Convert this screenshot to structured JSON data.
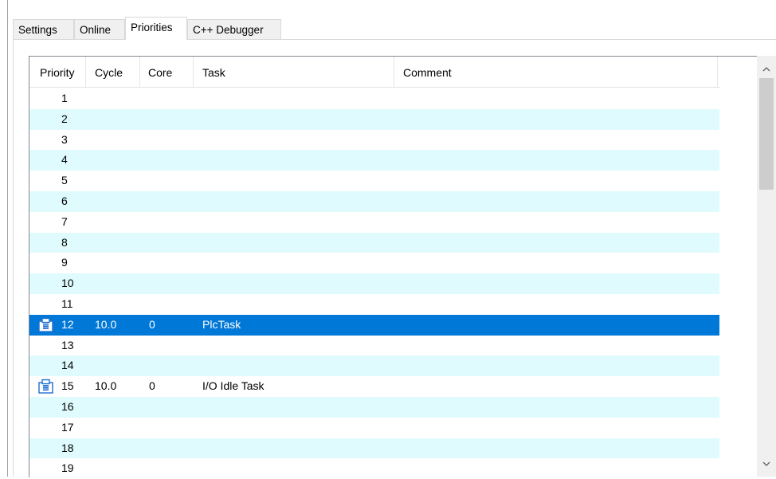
{
  "tabs": [
    {
      "label": "Settings",
      "active": false
    },
    {
      "label": "Online",
      "active": false
    },
    {
      "label": "Priorities",
      "active": true
    },
    {
      "label": "C++ Debugger",
      "active": false
    }
  ],
  "columns": [
    "Priority",
    "Cycle",
    "Core",
    "Task",
    "Comment"
  ],
  "rows": [
    {
      "priority": "1",
      "cycle": "",
      "core": "",
      "task": "",
      "comment": ""
    },
    {
      "priority": "2",
      "cycle": "",
      "core": "",
      "task": "",
      "comment": ""
    },
    {
      "priority": "3",
      "cycle": "",
      "core": "",
      "task": "",
      "comment": ""
    },
    {
      "priority": "4",
      "cycle": "",
      "core": "",
      "task": "",
      "comment": ""
    },
    {
      "priority": "5",
      "cycle": "",
      "core": "",
      "task": "",
      "comment": ""
    },
    {
      "priority": "6",
      "cycle": "",
      "core": "",
      "task": "",
      "comment": ""
    },
    {
      "priority": "7",
      "cycle": "",
      "core": "",
      "task": "",
      "comment": ""
    },
    {
      "priority": "8",
      "cycle": "",
      "core": "",
      "task": "",
      "comment": ""
    },
    {
      "priority": "9",
      "cycle": "",
      "core": "",
      "task": "",
      "comment": ""
    },
    {
      "priority": "10",
      "cycle": "",
      "core": "",
      "task": "",
      "comment": ""
    },
    {
      "priority": "11",
      "cycle": "",
      "core": "",
      "task": "",
      "comment": ""
    },
    {
      "priority": "12",
      "cycle": "10.0",
      "core": "0",
      "task": "PlcTask",
      "comment": "",
      "icon": "plc-task-icon",
      "selected": true
    },
    {
      "priority": "13",
      "cycle": "",
      "core": "",
      "task": "",
      "comment": ""
    },
    {
      "priority": "14",
      "cycle": "",
      "core": "",
      "task": "",
      "comment": ""
    },
    {
      "priority": "15",
      "cycle": "10.0",
      "core": "0",
      "task": "I/O Idle Task",
      "comment": "",
      "icon": "io-task-icon"
    },
    {
      "priority": "16",
      "cycle": "",
      "core": "",
      "task": "",
      "comment": ""
    },
    {
      "priority": "17",
      "cycle": "",
      "core": "",
      "task": "",
      "comment": ""
    },
    {
      "priority": "18",
      "cycle": "",
      "core": "",
      "task": "",
      "comment": ""
    },
    {
      "priority": "19",
      "cycle": "",
      "core": "",
      "task": "",
      "comment": ""
    }
  ],
  "colors": {
    "selection": "#0078d7",
    "alt_row": "#e0fbfd",
    "icon_blue": "#1e6fd0"
  },
  "scrollbar": {
    "up_icon": "chevron-up-icon",
    "down_icon": "chevron-down-icon"
  }
}
